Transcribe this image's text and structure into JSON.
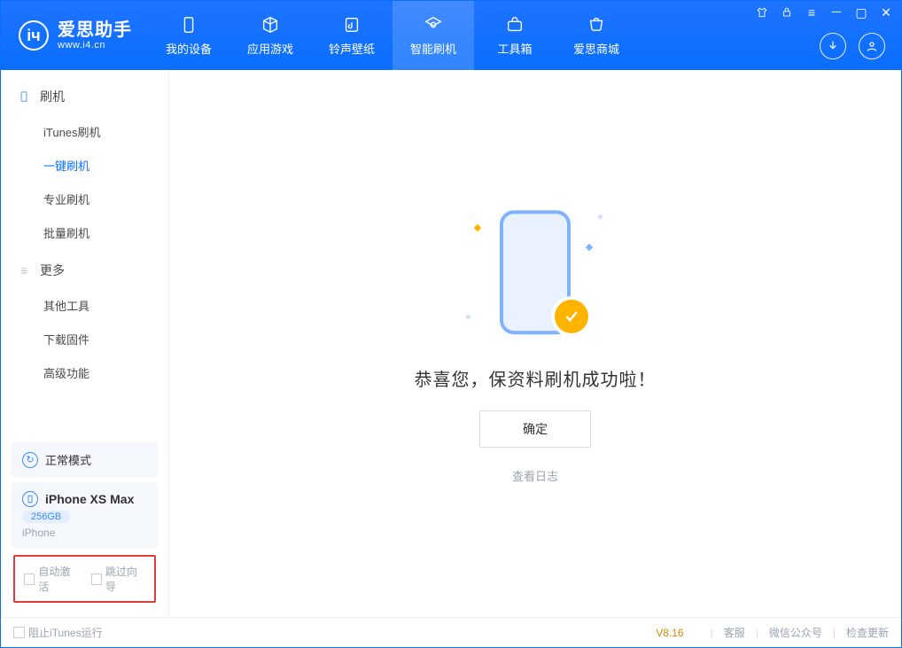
{
  "brand": {
    "title": "爱思助手",
    "subtitle": "www.i4.cn",
    "logo_letter": "iч"
  },
  "nav": {
    "items": [
      {
        "label": "我的设备",
        "icon": "device-icon"
      },
      {
        "label": "应用游戏",
        "icon": "cube-icon"
      },
      {
        "label": "铃声壁纸",
        "icon": "music-icon"
      },
      {
        "label": "智能刷机",
        "icon": "refresh-icon"
      },
      {
        "label": "工具箱",
        "icon": "toolbox-icon"
      },
      {
        "label": "爱思商城",
        "icon": "cart-icon"
      }
    ],
    "active_index": 3
  },
  "sidebar": {
    "section1": {
      "title": "刷机",
      "items": [
        "iTunes刷机",
        "一键刷机",
        "专业刷机",
        "批量刷机"
      ],
      "active_index": 1
    },
    "section2": {
      "title": "更多",
      "items": [
        "其他工具",
        "下载固件",
        "高级功能"
      ]
    },
    "mode": "正常模式",
    "device": {
      "name": "iPhone XS Max",
      "storage": "256GB",
      "type": "iPhone"
    },
    "options": {
      "auto_activate": "自动激活",
      "skip_guide": "跳过向导"
    }
  },
  "main": {
    "success_message": "恭喜您，保资料刷机成功啦！",
    "ok_button": "确定",
    "view_log": "查看日志"
  },
  "footer": {
    "block_itunes": "阻止iTunes运行",
    "version": "V8.16",
    "links": [
      "客服",
      "微信公众号",
      "检查更新"
    ]
  }
}
